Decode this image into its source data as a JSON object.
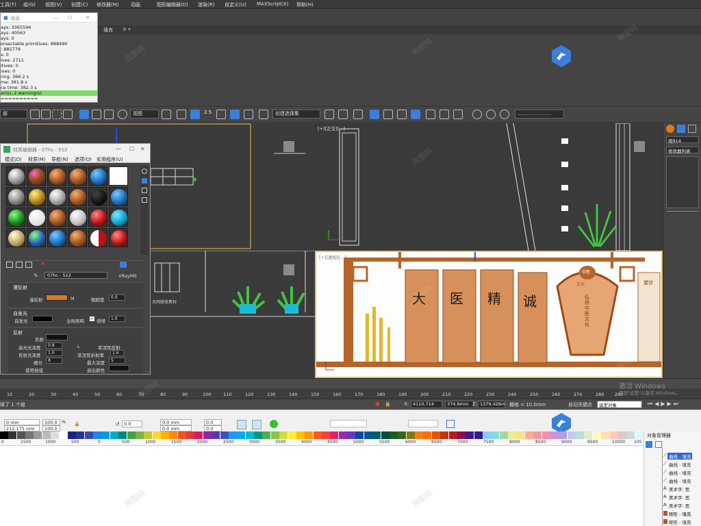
{
  "menu": {
    "items": [
      "工具(T)",
      "组(G)",
      "视图(V)",
      "创建(C)",
      "修改器(M)",
      "动画",
      "图形编辑器(D)",
      "渲染(R)",
      "自定义(U)",
      "MAXScript(X)",
      "帮助(H)"
    ]
  },
  "tab_label": "填充",
  "message_panel": {
    "title": "消息",
    "lines": [
      "ays: 3365594",
      "ays: 40563",
      "ays: 0",
      "ersectable primitives: 888490",
      ": 885779",
      "s: 0",
      "ives: 2711",
      "itives: 0",
      "ives: 0",
      "ring: 366.2 s",
      "me: 381.8 s",
      "ce time: 382.3 s",
      "or(s), 2 warning(s)",
      "=========="
    ],
    "selected_line": "or(s), 2 warning(s)"
  },
  "toolbar": {
    "scope_dropdown": "部",
    "view_dropdown": "视图",
    "spinner_value": "2.5",
    "selection_set": "创建选择集",
    "right_dropdown": "…………………"
  },
  "viewports": {
    "top_right_label": "[+][正交][...]",
    "bottom_right_label": "[+][透视][...]",
    "bottom_left_caption": "天网维修素材"
  },
  "scene": {
    "chars": [
      "大",
      "医",
      "精",
      "诚"
    ],
    "badge": "中医",
    "badge_sub": "文化",
    "vertical_text": "弘扬中医文化",
    "side_text": "望诊"
  },
  "command_panel": {
    "object_name": "组914",
    "modifier_list": "修改器列表"
  },
  "material_editor": {
    "title": "材质编辑器 - 07hc - 512",
    "menu": [
      "模式(D)",
      "材质(M)",
      "导航(N)",
      "选项(O)",
      "实用程序(U)"
    ],
    "material_name": "07hc - 512",
    "material_type": "VRayMtl",
    "diffuse_section": "漫反射",
    "diffuse_label": "漫反射",
    "roughness_label": "粗糙度",
    "roughness_value": "0.0",
    "selfillum_section": "自发光",
    "selfillum_label": "自发光",
    "gi_label": "全局照明",
    "multiplier_label": "倍增",
    "multiplier_value": "1.0",
    "reflection_section": "反射",
    "reflect_label": "反射",
    "hilight_gloss_label": "高光光泽度",
    "hilight_gloss_value": "0.8",
    "refl_gloss_label": "反射光泽度",
    "refl_gloss_value": "1.0",
    "subdivs_label": "细分",
    "subdivs_value": "8",
    "interp_label": "使用插值",
    "fresnel_label": "菲涅耳反射",
    "fresnel_ior_label": "菲涅耳折射率",
    "fresnel_ior_value": "1.6",
    "max_depth_label": "最大深度",
    "max_depth_value": "5",
    "exit_color_label": "退出颜色",
    "L_label": "L",
    "M_label": "M"
  },
  "timeline": {
    "ticks": [
      "10",
      "20",
      "30",
      "40",
      "50",
      "60",
      "70",
      "80",
      "90",
      "100",
      "110",
      "120",
      "130",
      "140",
      "150",
      "160",
      "170",
      "180",
      "190",
      "200",
      "210",
      "220",
      "230",
      "240",
      "250",
      "260",
      "270",
      "280",
      "290"
    ]
  },
  "status": {
    "selected": "择了 1 个组",
    "x_label": "X:",
    "x_value": "4110.714",
    "y_value": "374.9mm",
    "z_label": "Z:",
    "z_value": "1379.426m",
    "grid": "栅格 = 10.0mm",
    "autokey": "自动关键点",
    "selobj": "选定对象",
    "activate": "激活 Windows",
    "activate_sub": "转到\"设置\"以激活 Windows。"
  },
  "corel": {
    "w_value": "0 mm",
    "h_value": "212.175 mm",
    "sx": "100.0",
    "sy": "100.0",
    "pct": "%",
    "angle": "0.0",
    "pos1": "0.0 mm",
    "pos2": "0.0 mm",
    "p1": "0.0",
    "p2": "0.0",
    "ruler": [
      "0",
      "1500",
      "1000",
      "500",
      "0",
      "500",
      "1000",
      "1500",
      "2000",
      "2500",
      "3000",
      "3500",
      "4000",
      "4500",
      "5000",
      "5500",
      "6000",
      "6500",
      "7000",
      "7500",
      "8000",
      "8500",
      "9000",
      "9500",
      "10000",
      "105"
    ],
    "obj_manager_title": "对象管理器",
    "obj_rows": [
      "曲线 - 填充",
      "曲线 - 填充",
      "曲线 - 填充",
      "曲线 - 填充",
      "美术字: 思",
      "美术字: 思",
      "美术字: 思",
      "矩形 - 填充",
      "矩形 - 填充"
    ]
  },
  "watermark": "我图网",
  "colors": {
    "accent_blue": "#3b7fd9",
    "selection_green": "#7fdc6a",
    "viewport_border": "#e8c25b",
    "diffuse_orange": "#e07a1c"
  }
}
